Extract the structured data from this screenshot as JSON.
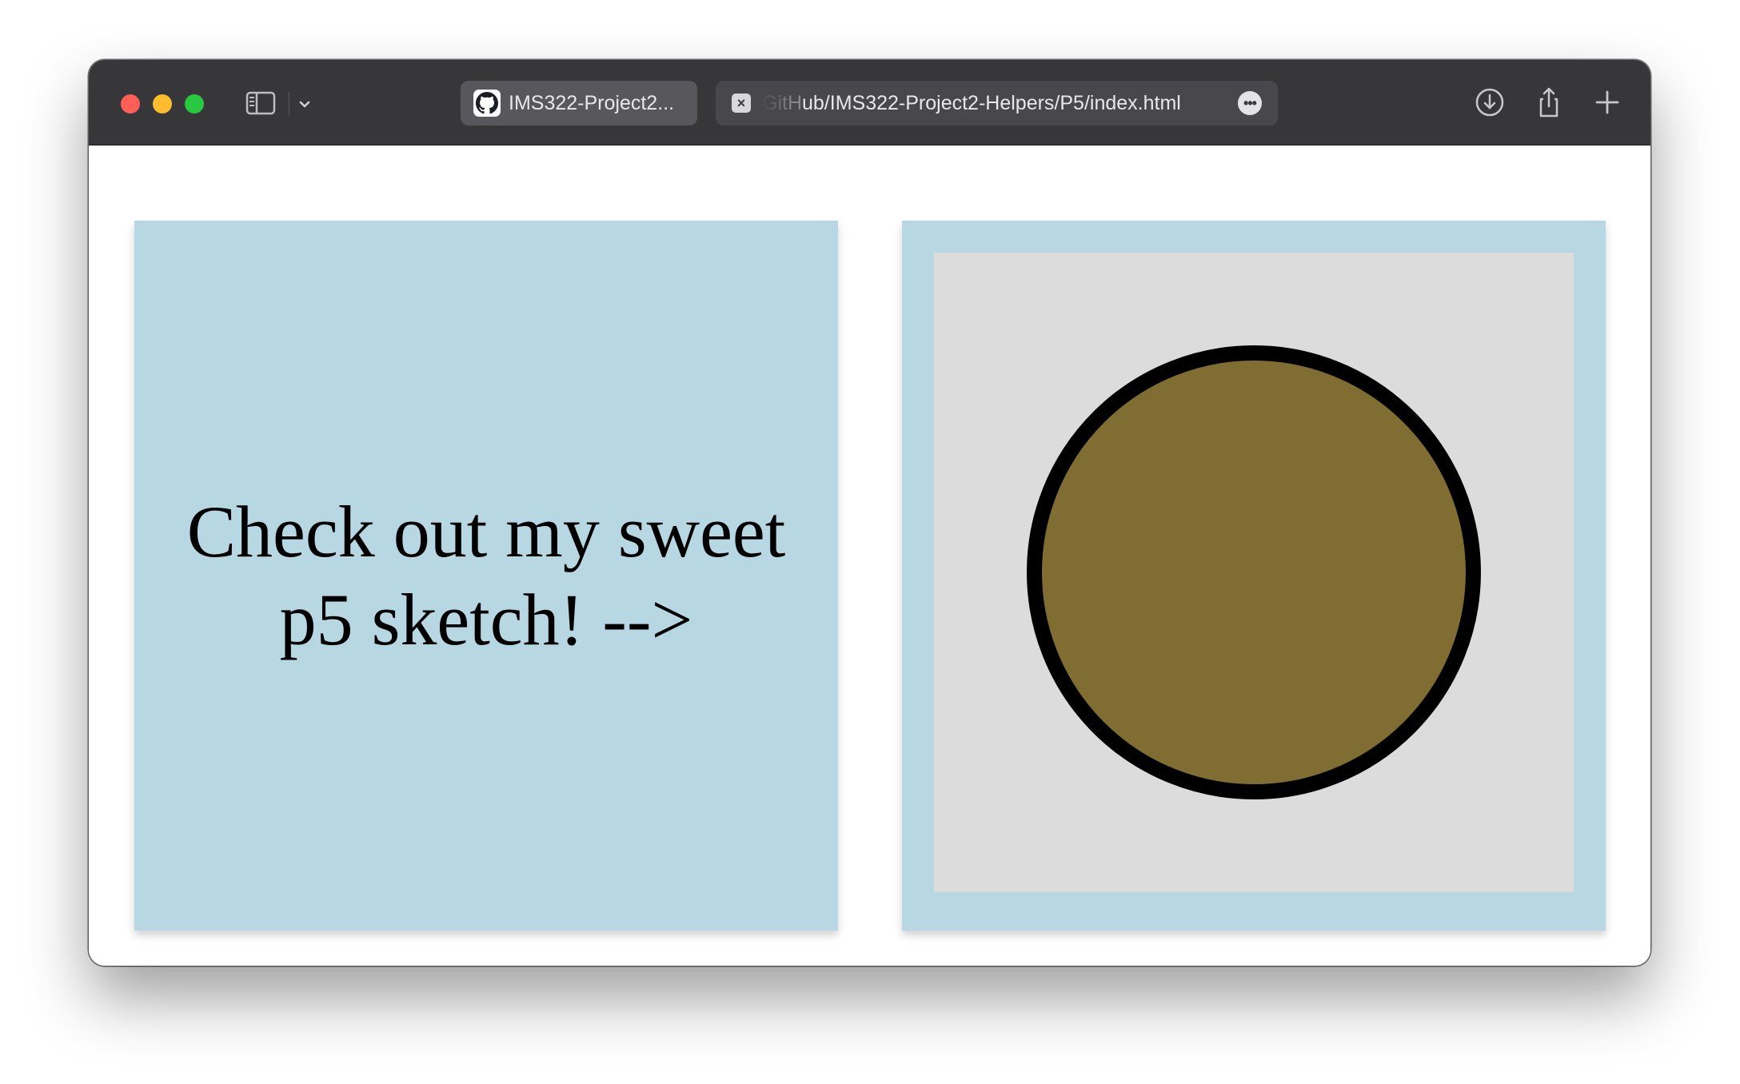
{
  "browser": {
    "tabs": [
      {
        "title": "IMS322-Project2...",
        "favicon": "github-icon",
        "active": true
      },
      {
        "url_faded_prefix": "GitH",
        "url_rest": "ub/IMS322-Project2-Helpers/P5/index.html",
        "favicon": "close-icon",
        "active": false
      }
    ],
    "toolbar_icons": [
      "sidebar-icon",
      "chevron-down-icon",
      "download-icon",
      "share-icon",
      "new-tab-icon",
      "more-icon"
    ]
  },
  "page": {
    "left_card_text": "Check out my sweet p5 sketch! -->",
    "colors": {
      "card_background": "#b7d7e3",
      "canvas_background": "#dcdcdc",
      "circle_fill": "#806d32",
      "circle_stroke": "#000000"
    }
  }
}
